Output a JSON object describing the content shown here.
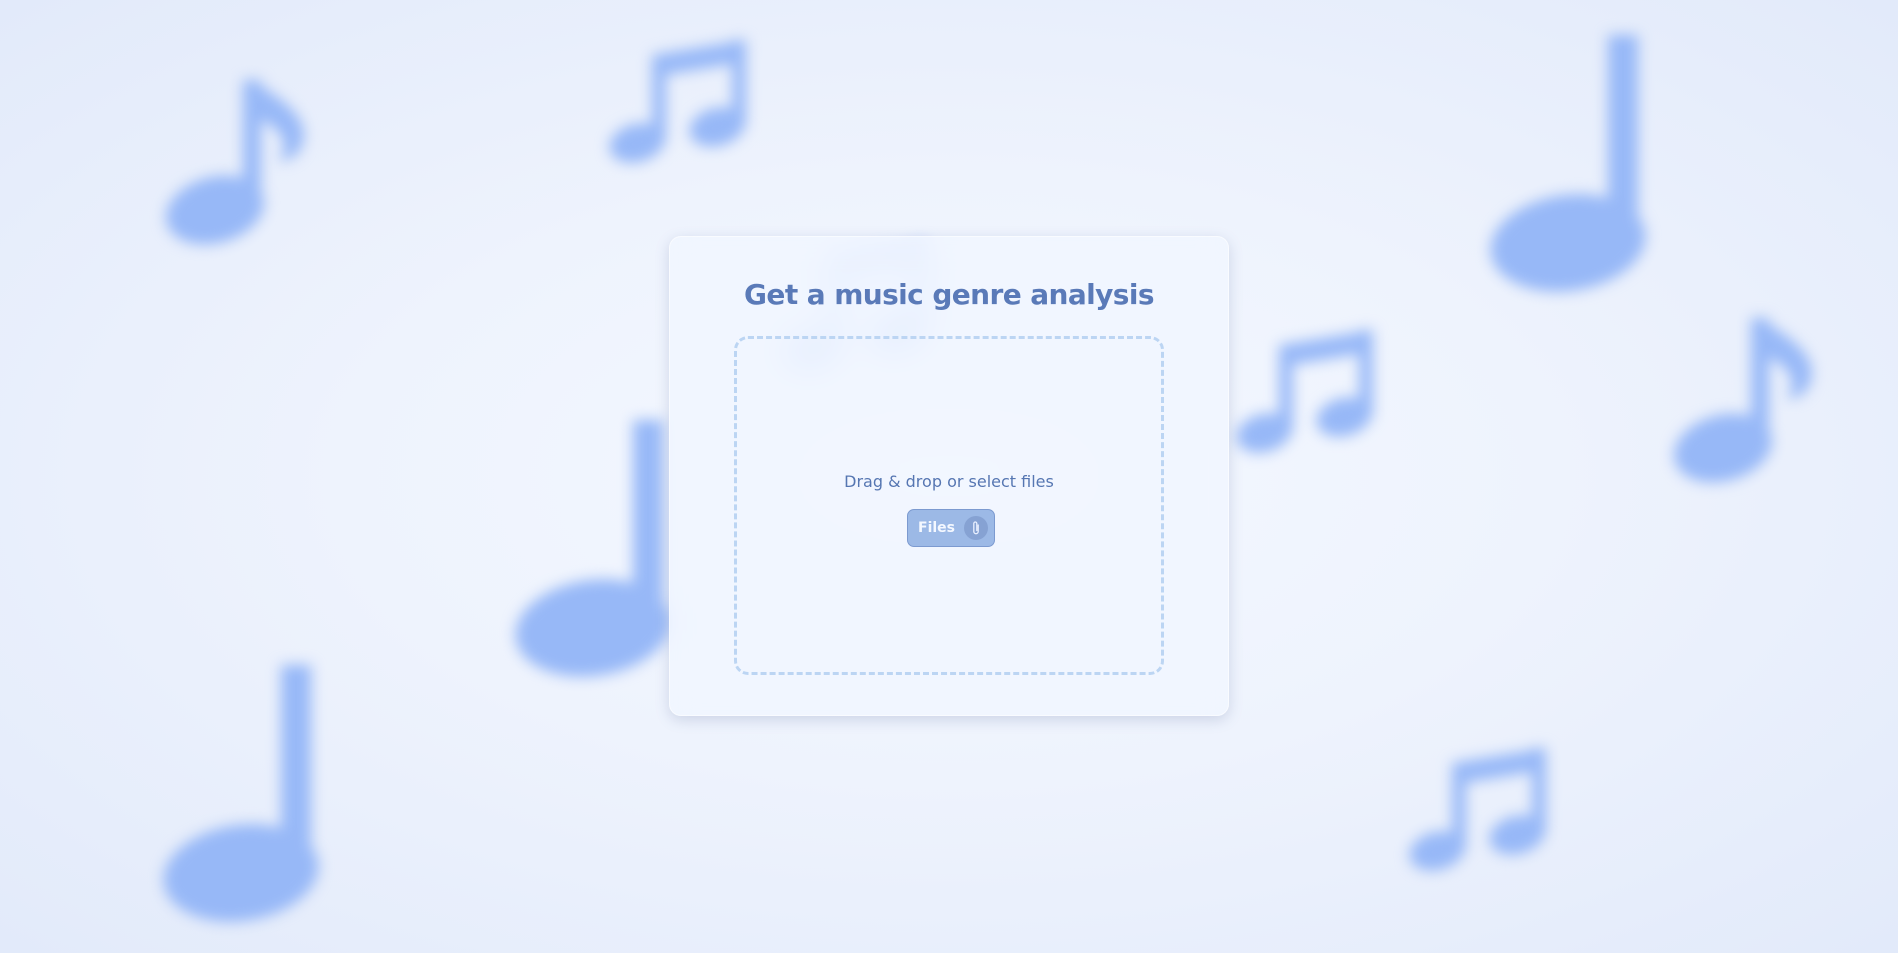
{
  "title": "Get a music genre analysis",
  "dropzone": {
    "prompt": "Drag & drop or select files",
    "button_label": "Files",
    "button_icon": "paperclip-icon"
  },
  "background": {
    "decoration_icon": "music-note-icon",
    "note_color": "#97b8f7"
  },
  "colors": {
    "accent": "#5a7ab8",
    "button": "#9cb9e6",
    "dropzone_border": "#bcd5f3"
  }
}
